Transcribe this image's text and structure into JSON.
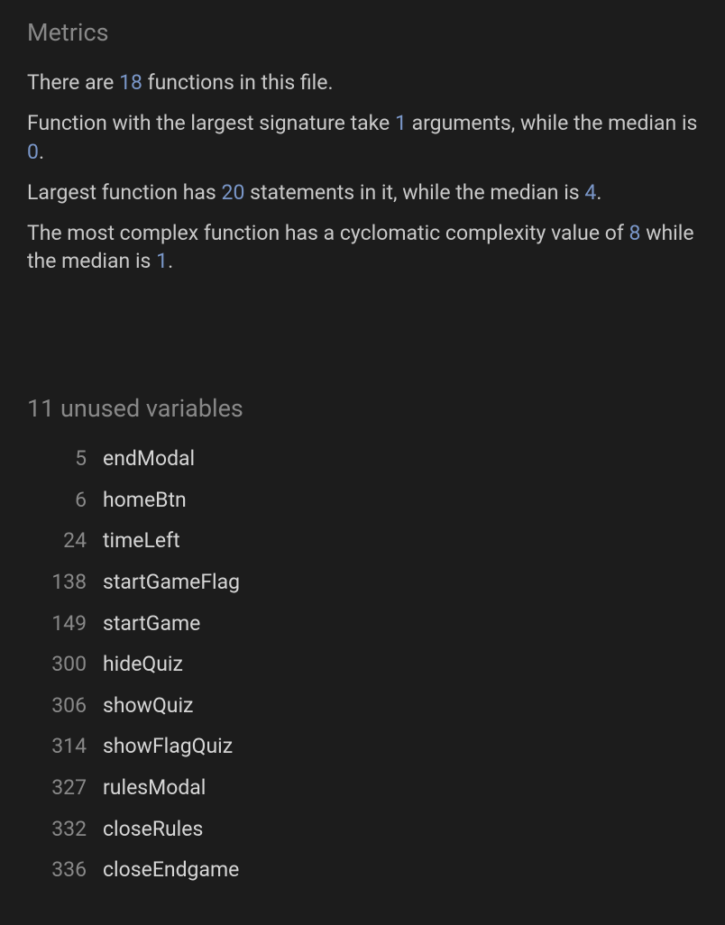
{
  "metrics": {
    "heading": "Metrics",
    "line1_a": "There are ",
    "line1_num": "18",
    "line1_b": " functions in this file.",
    "line2_a": "Function with the largest signature take ",
    "line2_num1": "1",
    "line2_b": " arguments, while the median is ",
    "line2_num2": "0",
    "line2_c": ".",
    "line3_a": "Largest function has ",
    "line3_num1": "20",
    "line3_b": " statements in it, while the median is ",
    "line3_num2": "4",
    "line3_c": ".",
    "line4_a": "The most complex function has a cyclomatic complexity value of ",
    "line4_num1": "8",
    "line4_b": " while the median is ",
    "line4_num2": "1",
    "line4_c": "."
  },
  "unused": {
    "heading": "11 unused variables",
    "items": [
      {
        "line": "5",
        "name": "endModal"
      },
      {
        "line": "6",
        "name": "homeBtn"
      },
      {
        "line": "24",
        "name": "timeLeft"
      },
      {
        "line": "138",
        "name": "startGameFlag"
      },
      {
        "line": "149",
        "name": "startGame"
      },
      {
        "line": "300",
        "name": "hideQuiz"
      },
      {
        "line": "306",
        "name": "showQuiz"
      },
      {
        "line": "314",
        "name": "showFlagQuiz"
      },
      {
        "line": "327",
        "name": "rulesModal"
      },
      {
        "line": "332",
        "name": "closeRules"
      },
      {
        "line": "336",
        "name": "closeEndgame"
      }
    ]
  }
}
